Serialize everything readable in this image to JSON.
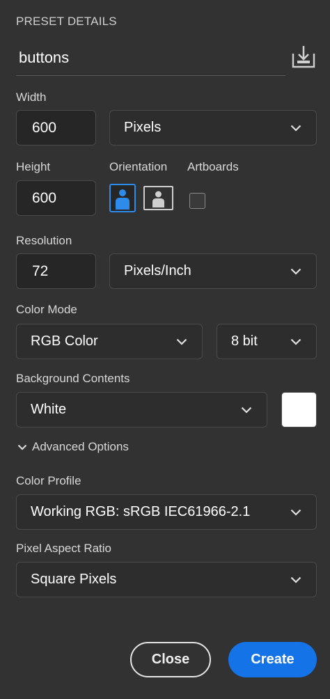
{
  "preset": {
    "section_title": "PRESET DETAILS",
    "name": "buttons",
    "save_icon": "save-preset-icon"
  },
  "width": {
    "label": "Width",
    "value": "600",
    "unit": "Pixels"
  },
  "height": {
    "label": "Height",
    "value": "600"
  },
  "orientation": {
    "label": "Orientation",
    "selected": "portrait",
    "accent": "#2d8ceb"
  },
  "artboards": {
    "label": "Artboards",
    "checked": false
  },
  "resolution": {
    "label": "Resolution",
    "value": "72",
    "unit": "Pixels/Inch"
  },
  "color_mode": {
    "label": "Color Mode",
    "mode": "RGB Color",
    "bit_depth": "8 bit"
  },
  "background": {
    "label": "Background Contents",
    "value": "White",
    "swatch_color": "#ffffff"
  },
  "advanced": {
    "toggle_label": "Advanced Options",
    "expanded": true
  },
  "color_profile": {
    "label": "Color Profile",
    "value": "Working RGB: sRGB IEC61966-2.1"
  },
  "pixel_aspect": {
    "label": "Pixel Aspect Ratio",
    "value": "Square Pixels"
  },
  "actions": {
    "close_label": "Close",
    "create_label": "Create",
    "create_color": "#1473e6"
  }
}
